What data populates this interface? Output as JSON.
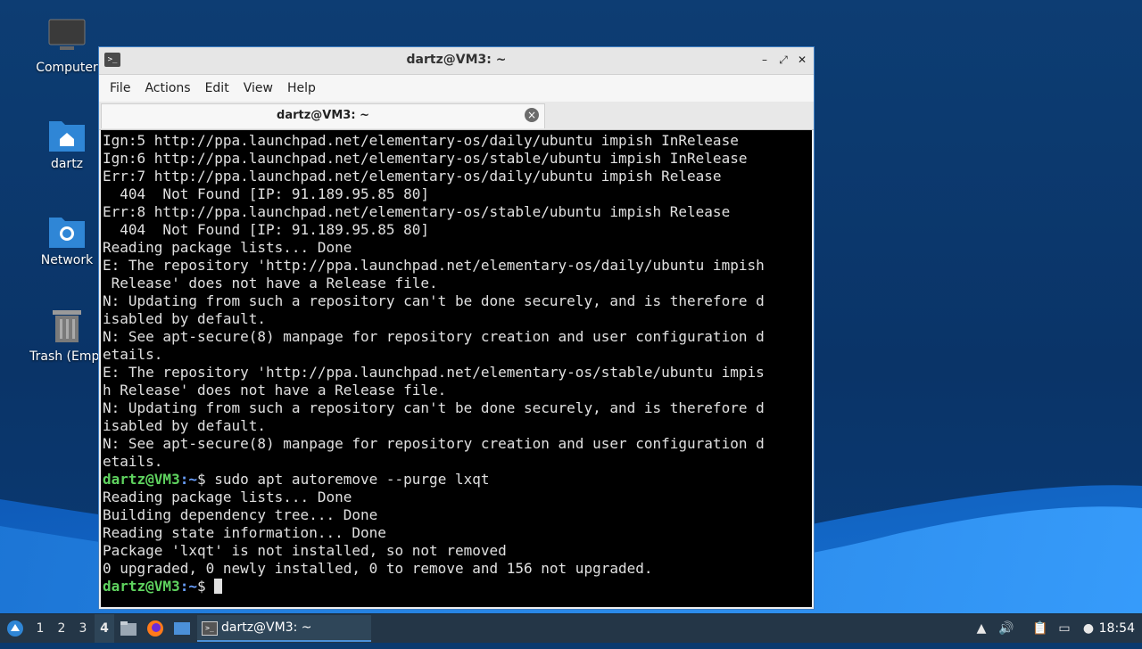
{
  "desktop": {
    "icons": [
      {
        "label": "Computer",
        "icon": "computer-icon"
      },
      {
        "label": "dartz",
        "icon": "home-folder-icon"
      },
      {
        "label": "Network",
        "icon": "network-folder-icon"
      },
      {
        "label": "Trash (Empt",
        "icon": "trash-icon"
      }
    ]
  },
  "window": {
    "title": "dartz@VM3: ~",
    "menu": [
      "File",
      "Actions",
      "Edit",
      "View",
      "Help"
    ],
    "tab_label": "dartz@VM3: ~",
    "controls": {
      "minimize": "–",
      "maximize": "⤢",
      "close": "✕"
    }
  },
  "terminal": {
    "lines": [
      "Ign:5 http://ppa.launchpad.net/elementary-os/daily/ubuntu impish InRelease",
      "Ign:6 http://ppa.launchpad.net/elementary-os/stable/ubuntu impish InRelease",
      "Err:7 http://ppa.launchpad.net/elementary-os/daily/ubuntu impish Release",
      "  404  Not Found [IP: 91.189.95.85 80]",
      "Err:8 http://ppa.launchpad.net/elementary-os/stable/ubuntu impish Release",
      "  404  Not Found [IP: 91.189.95.85 80]",
      "Reading package lists... Done",
      "E: The repository 'http://ppa.launchpad.net/elementary-os/daily/ubuntu impish",
      " Release' does not have a Release file.",
      "N: Updating from such a repository can't be done securely, and is therefore d",
      "isabled by default.",
      "N: See apt-secure(8) manpage for repository creation and user configuration d",
      "etails.",
      "E: The repository 'http://ppa.launchpad.net/elementary-os/stable/ubuntu impis",
      "h Release' does not have a Release file.",
      "N: Updating from such a repository can't be done securely, and is therefore d",
      "isabled by default.",
      "N: See apt-secure(8) manpage for repository creation and user configuration d",
      "etails."
    ],
    "prompt_user": "dartz@VM3",
    "prompt_path": ":~",
    "prompt_symbol": "$ ",
    "command": "sudo apt autoremove --purge lxqt",
    "output": [
      "Reading package lists... Done",
      "Building dependency tree... Done",
      "Reading state information... Done",
      "Package 'lxqt' is not installed, so not removed",
      "0 upgraded, 0 newly installed, 0 to remove and 156 not upgraded."
    ]
  },
  "taskbar": {
    "workspaces": [
      "1",
      "2",
      "3",
      "4"
    ],
    "active_workspace": "4",
    "task_label": "dartz@VM3: ~",
    "clock": "18:54"
  },
  "colors": {
    "prompt_user": "#5fd35f",
    "prompt_path": "#6aa0ff",
    "window_border": "#3f7fc4",
    "taskbar_bg": "#243647"
  }
}
